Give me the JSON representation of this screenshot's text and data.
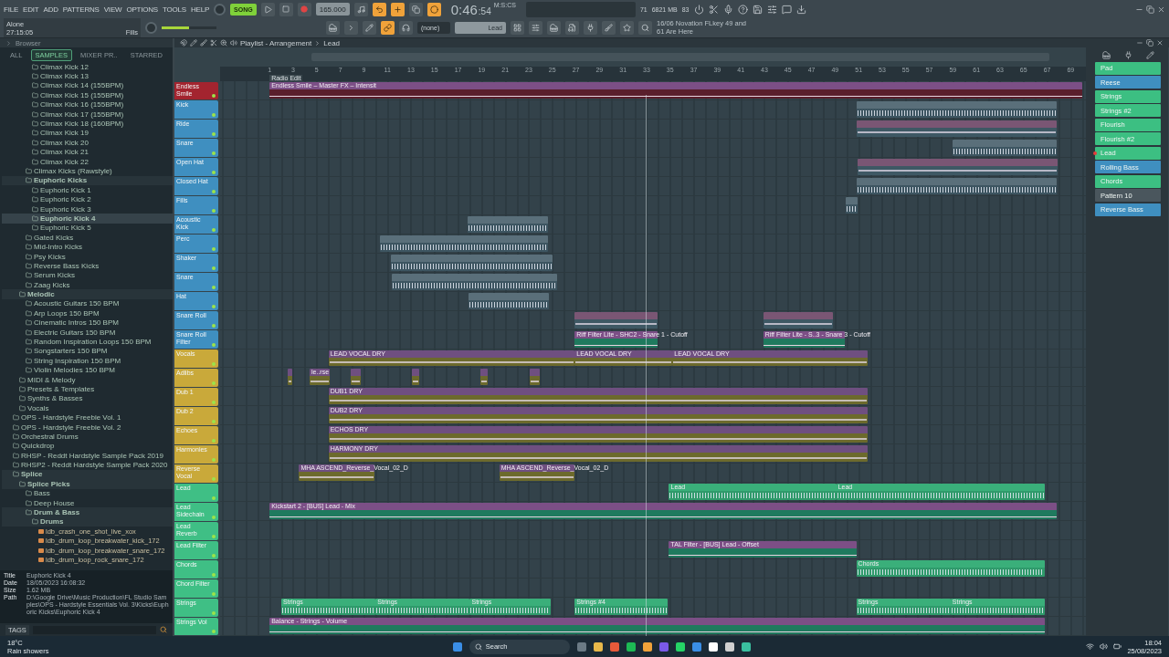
{
  "menu": [
    "FILE",
    "EDIT",
    "ADD",
    "PATTERNS",
    "VIEW",
    "OPTIONS",
    "TOOLS",
    "HELP"
  ],
  "song_info": {
    "title": "Alone",
    "time": "27:15:05",
    "pattern": "Fills"
  },
  "transport": {
    "mode": "SONG",
    "tempo": "165.000"
  },
  "clock": {
    "main": "0:46",
    "sub": ":54",
    "unit": "M:S:CS"
  },
  "monitor": {
    "poly": "71",
    "memory": "6821 MB",
    "cpu": "83"
  },
  "pattern_selector": {
    "channel": "(none)",
    "pattern": "Lead"
  },
  "master_volume": {
    "level": 0.5
  },
  "hint": "16/06 Novation FLkey 49 and 61 Are Here",
  "browser": {
    "title": "Browser",
    "tabs": [
      {
        "label": "ALL",
        "selected": false
      },
      {
        "label": "SAMPLES",
        "selected": true
      },
      {
        "label": "MIXER PR..",
        "selected": false
      },
      {
        "label": "STARRED",
        "selected": false
      }
    ],
    "items": [
      {
        "children": [
          {
            "children": [
              {
                "children": [
                  {
                    "label": "Climax Kick 12",
                    "kind": "folder",
                    "expanded": false,
                    "selected": false
                  },
                  {
                    "label": "Climax Kick 13",
                    "kind": "folder",
                    "expanded": false,
                    "selected": false
                  },
                  {
                    "label": "Climax Kick 14 (155BPM)",
                    "kind": "folder",
                    "expanded": false,
                    "selected": false
                  },
                  {
                    "label": "Climax Kick 15 (155BPM)",
                    "kind": "folder",
                    "expanded": false,
                    "selected": false
                  },
                  {
                    "label": "Climax Kick 16 (155BPM)",
                    "kind": "folder",
                    "expanded": false,
                    "selected": false
                  },
                  {
                    "label": "Climax Kick 17 (155BPM)",
                    "kind": "folder",
                    "expanded": false,
                    "selected": false
                  },
                  {
                    "label": "Climax Kick 18 (160BPM)",
                    "kind": "folder",
                    "expanded": false,
                    "selected": false
                  },
                  {
                    "label": "Climax Kick 19",
                    "kind": "folder",
                    "expanded": false,
                    "selected": false
                  },
                  {
                    "label": "Climax Kick 20",
                    "kind": "folder",
                    "expanded": false,
                    "selected": false
                  },
                  {
                    "label": "Climax Kick 21",
                    "kind": "folder",
                    "expanded": false,
                    "selected": false
                  },
                  {
                    "label": "Climax Kick 22",
                    "kind": "folder",
                    "expanded": false,
                    "selected": false
                  }
                ]
              },
              {
                "label": "Climax Kicks (Rawstyle)",
                "kind": "folder",
                "expanded": false,
                "selected": false
              },
              {
                "label": "Euphoric Kicks",
                "kind": "folder",
                "expanded": true,
                "selected": false,
                "children": [
                  {
                    "label": "Euphoric Kick 1",
                    "kind": "folder",
                    "expanded": false,
                    "selected": false
                  },
                  {
                    "label": "Euphoric Kick 2",
                    "kind": "folder",
                    "expanded": false,
                    "selected": false
                  },
                  {
                    "label": "Euphoric Kick 3",
                    "kind": "folder",
                    "expanded": false,
                    "selected": false
                  },
                  {
                    "label": "Euphoric Kick 4",
                    "kind": "folder",
                    "expanded": false,
                    "selected": true
                  },
                  {
                    "label": "Euphoric Kick 5",
                    "kind": "folder",
                    "expanded": false,
                    "selected": false
                  }
                ]
              },
              {
                "label": "Gated Kicks",
                "kind": "folder",
                "expanded": false,
                "selected": false
              },
              {
                "label": "Mid-Intro Kicks",
                "kind": "folder",
                "expanded": false,
                "selected": false
              },
              {
                "label": "Psy Kicks",
                "kind": "folder",
                "expanded": false,
                "selected": false
              },
              {
                "label": "Reverse Bass Kicks",
                "kind": "folder",
                "expanded": false,
                "selected": false
              },
              {
                "label": "Serum Kicks",
                "kind": "folder",
                "expanded": false,
                "selected": false
              },
              {
                "label": "Zaag Kicks",
                "kind": "folder",
                "expanded": false,
                "selected": false
              }
            ]
          },
          {
            "label": "Melodic",
            "kind": "folder",
            "expanded": true,
            "selected": false,
            "children": [
              {
                "label": "Acoustic Guitars 150 BPM",
                "kind": "folder",
                "expanded": false,
                "selected": false
              },
              {
                "label": "Arp Loops 150 BPM",
                "kind": "folder",
                "expanded": false,
                "selected": false
              },
              {
                "label": "Cinematic Intros 150 BPM",
                "kind": "folder",
                "expanded": false,
                "selected": false
              },
              {
                "label": "Electric Guitars 150 BPM",
                "kind": "folder",
                "expanded": false,
                "selected": false
              },
              {
                "label": "Random Inspiration Loops 150 BPM",
                "kind": "folder",
                "expanded": false,
                "selected": false
              },
              {
                "label": "Songstarters 150 BPM",
                "kind": "folder",
                "expanded": false,
                "selected": false
              },
              {
                "label": "String Inspiration 150 BPM",
                "kind": "folder",
                "expanded": false,
                "selected": false
              },
              {
                "label": "Violin Melodies 150 BPM",
                "kind": "folder",
                "expanded": false,
                "selected": false
              }
            ]
          },
          {
            "label": "MIDI & Melody",
            "kind": "folder",
            "expanded": false,
            "selected": false
          },
          {
            "label": "Presets & Templates",
            "kind": "folder",
            "expanded": false,
            "selected": false
          },
          {
            "label": "Synths & Basses",
            "kind": "folder",
            "expanded": false,
            "selected": false
          },
          {
            "label": "Vocals",
            "kind": "folder",
            "expanded": false,
            "selected": false
          }
        ]
      },
      {
        "label": "OPS - Hardstyle Freebie Vol. 1",
        "kind": "folder",
        "expanded": false,
        "selected": false
      },
      {
        "label": "OPS - Hardstyle Freebie Vol. 2",
        "kind": "folder",
        "expanded": false,
        "selected": false
      },
      {
        "label": "Orchestral Drums",
        "kind": "folder",
        "expanded": false,
        "selected": false
      },
      {
        "label": "Quickdrop",
        "kind": "folder",
        "expanded": false,
        "selected": false
      },
      {
        "label": "RHSP - Reddt Hardstyle Sample Pack 2019",
        "kind": "folder",
        "expanded": false,
        "selected": false
      },
      {
        "label": "RHSP2 - Reddt Hardstyle Sample Pack 2020",
        "kind": "folder",
        "expanded": false,
        "selected": false
      },
      {
        "label": "Splice",
        "kind": "folder",
        "expanded": true,
        "selected": false,
        "children": [
          {
            "label": "Splice Picks",
            "kind": "folder",
            "expanded": true,
            "selected": false,
            "children": [
              {
                "label": "Bass",
                "kind": "folder",
                "expanded": false,
                "selected": false
              },
              {
                "label": "Deep House",
                "kind": "folder",
                "expanded": false,
                "selected": false
              },
              {
                "label": "Drum & Bass",
                "kind": "folder",
                "expanded": true,
                "selected": false,
                "children": [
                  {
                    "label": "Drums",
                    "kind": "folder",
                    "expanded": true,
                    "selected": false,
                    "children": [
                      {
                        "label": "ldb_crash_one_shot_live_xox",
                        "kind": "file",
                        "selected": false
                      },
                      {
                        "label": "ldb_drum_loop_breakwater_kick_172",
                        "kind": "file",
                        "selected": false
                      },
                      {
                        "label": "ldb_drum_loop_breakwater_snare_172",
                        "kind": "file",
                        "selected": false
                      },
                      {
                        "label": "ldb_drum_loop_rock_snare_172",
                        "kind": "file",
                        "selected": false
                      }
                    ]
                  }
                ]
              }
            ]
          }
        ]
      }
    ],
    "info": [
      {
        "key": "Title",
        "value": "Euphoric Kick 4"
      },
      {
        "key": "Date",
        "value": "18/05/2023 16:08:32"
      },
      {
        "key": "Size",
        "value": "1.62 MB"
      },
      {
        "key": "Path",
        "value": "D:\\Google Drive\\Music Production\\FL Studio Samples\\OPS - Hardstyle Essentials Vol. 3\\Kicks\\Euphoric Kicks\\Euphoric Kick 4"
      }
    ],
    "tags_label": "TAGS"
  },
  "playlist": {
    "title": "Playlist - Arrangement",
    "pattern": "Lead",
    "marker": "Radio Edit",
    "ruler": [
      "1",
      "3",
      "5",
      "7",
      "9",
      "11",
      "13",
      "15",
      "17",
      "19",
      "21",
      "23",
      "25",
      "27",
      "29",
      "31",
      "33",
      "35",
      "37",
      "39",
      "41",
      "43",
      "45",
      "47",
      "49",
      "51",
      "53",
      "55",
      "57",
      "59",
      "61",
      "63",
      "65",
      "67",
      "69"
    ],
    "tracks": [
      {
        "name": "Endless Smile",
        "color": "#a3242f",
        "clips": [
          {
            "kind": "automation",
            "label": "Endless Smile – Master FX – Intensit"
          }
        ]
      },
      {
        "name": "Kick",
        "color": "#3f8fc0",
        "clips": [
          {
            "kind": "pattern"
          }
        ]
      },
      {
        "name": "Ride",
        "color": "#3f8fc0",
        "clips": [
          {
            "kind": "audio"
          }
        ]
      },
      {
        "name": "Snare",
        "color": "#3f8fc0",
        "clips": [
          {
            "kind": "pattern"
          }
        ]
      },
      {
        "name": "Open Hat",
        "color": "#3f8fc0",
        "clips": [
          {
            "kind": "audio"
          }
        ]
      },
      {
        "name": "Closed Hat",
        "color": "#3f8fc0",
        "clips": [
          {
            "kind": "pattern"
          }
        ]
      },
      {
        "name": "Fills",
        "color": "#3f8fc0",
        "clips": [
          {
            "kind": "pattern"
          }
        ]
      },
      {
        "name": "Acoustic Kick",
        "color": "#3f8fc0",
        "clips": [
          {
            "kind": "pattern"
          }
        ]
      },
      {
        "name": "Perc",
        "color": "#3f8fc0",
        "clips": [
          {
            "kind": "pattern"
          }
        ]
      },
      {
        "name": "Shaker",
        "color": "#3f8fc0",
        "clips": [
          {
            "kind": "pattern"
          }
        ]
      },
      {
        "name": "Snare",
        "color": "#3f8fc0",
        "clips": [
          {
            "kind": "pattern"
          }
        ]
      },
      {
        "name": "Hat",
        "color": "#3f8fc0",
        "clips": [
          {
            "kind": "pattern"
          }
        ]
      },
      {
        "name": "Snare Roll",
        "color": "#3f8fc0",
        "clips": [
          {
            "kind": "audio"
          },
          {
            "kind": "audio"
          }
        ]
      },
      {
        "name": "Snare Roll Filter",
        "color": "#3f8fc0",
        "clips": [
          {
            "kind": "automation",
            "label": "Riff Filter Lite - SHC2 - Snare 1 - Cutoff"
          },
          {
            "kind": "automation",
            "label": "Riff Filter Lite - S..3 - Snare 3 - Cutoff"
          }
        ]
      },
      {
        "name": "Vocals",
        "color": "#c9a93a",
        "clips": [
          {
            "kind": "audio",
            "label": "LEAD VOCAL DRY"
          },
          {
            "kind": "audio",
            "label": "LEAD VOCAL DRY"
          },
          {
            "kind": "audio",
            "label": "LEAD VOCAL DRY"
          }
        ]
      },
      {
        "name": "Adlibs",
        "color": "#c9a93a",
        "clips": [
          {
            "kind": "audio"
          },
          {
            "kind": "audio",
            "label": "le..rse"
          },
          {
            "kind": "audio"
          },
          {
            "kind": "audio"
          },
          {
            "kind": "audio"
          },
          {
            "kind": "audio"
          }
        ]
      },
      {
        "name": "Dub 1",
        "color": "#c9a93a",
        "clips": [
          {
            "kind": "audio",
            "label": "DUB1 DRY"
          }
        ]
      },
      {
        "name": "Dub 2",
        "color": "#c9a93a",
        "clips": [
          {
            "kind": "audio",
            "label": "DUB2 DRY"
          }
        ]
      },
      {
        "name": "Echoes",
        "color": "#c9a93a",
        "clips": [
          {
            "kind": "audio",
            "label": "ECHOS DRY"
          }
        ]
      },
      {
        "name": "Harmonies",
        "color": "#c9a93a",
        "clips": [
          {
            "kind": "audio",
            "label": "HARMONY DRY"
          }
        ]
      },
      {
        "name": "Reverse Vocal",
        "color": "#c9a93a",
        "clips": [
          {
            "kind": "audio",
            "label": "MHA ASCEND_Reverse_Vocal_02_D"
          },
          {
            "kind": "audio",
            "label": "MHA ASCEND_Reverse_Vocal_02_D"
          }
        ]
      },
      {
        "name": "Lead",
        "color": "#3fbf85",
        "clips": [
          {
            "kind": "pattern",
            "label": "Lead"
          },
          {
            "kind": "pattern",
            "label": "Lead"
          }
        ]
      },
      {
        "name": "Lead Sidechain",
        "color": "#3fbf85",
        "clips": [
          {
            "kind": "automation",
            "label": "Kickstart 2 - [BUS] Lead - Mix"
          }
        ]
      },
      {
        "name": "Lead Reverb",
        "color": "#3fbf85"
      },
      {
        "name": "Lead Filter",
        "color": "#3fbf85",
        "clips": [
          {
            "kind": "automation",
            "label": "TAL Filter - [BUS] Lead - Offset"
          }
        ]
      },
      {
        "name": "Chords",
        "color": "#3fbf85",
        "clips": [
          {
            "kind": "pattern",
            "label": "Chords"
          }
        ]
      },
      {
        "name": "Chord Filter",
        "color": "#3fbf85"
      },
      {
        "name": "Strings",
        "color": "#3fbf85",
        "clips": [
          {
            "kind": "pattern",
            "label": "Strings"
          },
          {
            "kind": "pattern",
            "label": "Strings"
          },
          {
            "kind": "pattern",
            "label": "Strings"
          },
          {
            "kind": "pattern",
            "label": "Strings #4"
          },
          {
            "kind": "pattern",
            "label": "Strings"
          },
          {
            "kind": "pattern",
            "label": "Strings"
          }
        ]
      },
      {
        "name": "Strings Vol",
        "color": "#3fbf85",
        "clips": [
          {
            "kind": "automation",
            "label": "Balance - Strings - Volume"
          }
        ]
      }
    ]
  },
  "patterns": [
    {
      "label": "Pad",
      "color": "#3cbf82",
      "selected": false
    },
    {
      "label": "Reese",
      "color": "#3f8fc0",
      "selected": false
    },
    {
      "label": "Strings",
      "color": "#3cbf82",
      "selected": false
    },
    {
      "label": "Strings #2",
      "color": "#3cbf82",
      "selected": false
    },
    {
      "label": "Flourish",
      "color": "#3cbf82",
      "selected": false
    },
    {
      "label": "Flourish #2",
      "color": "#3cbf82",
      "selected": false
    },
    {
      "label": "Lead",
      "color": "#3cbf82",
      "selected": true
    },
    {
      "label": "Rolling Bass",
      "color": "#3f8fc0",
      "selected": false
    },
    {
      "label": "Chords",
      "color": "#3cbf82",
      "selected": false
    },
    {
      "label": "Pattern 10",
      "color": "#4a565d",
      "selected": false
    },
    {
      "label": "Reverse Bass",
      "color": "#3f8fc0",
      "selected": false
    }
  ],
  "taskbar": {
    "temperature": "18°C",
    "weather": "Rain showers",
    "search": "Search",
    "time": "18:04",
    "date": "25/08/2023"
  }
}
